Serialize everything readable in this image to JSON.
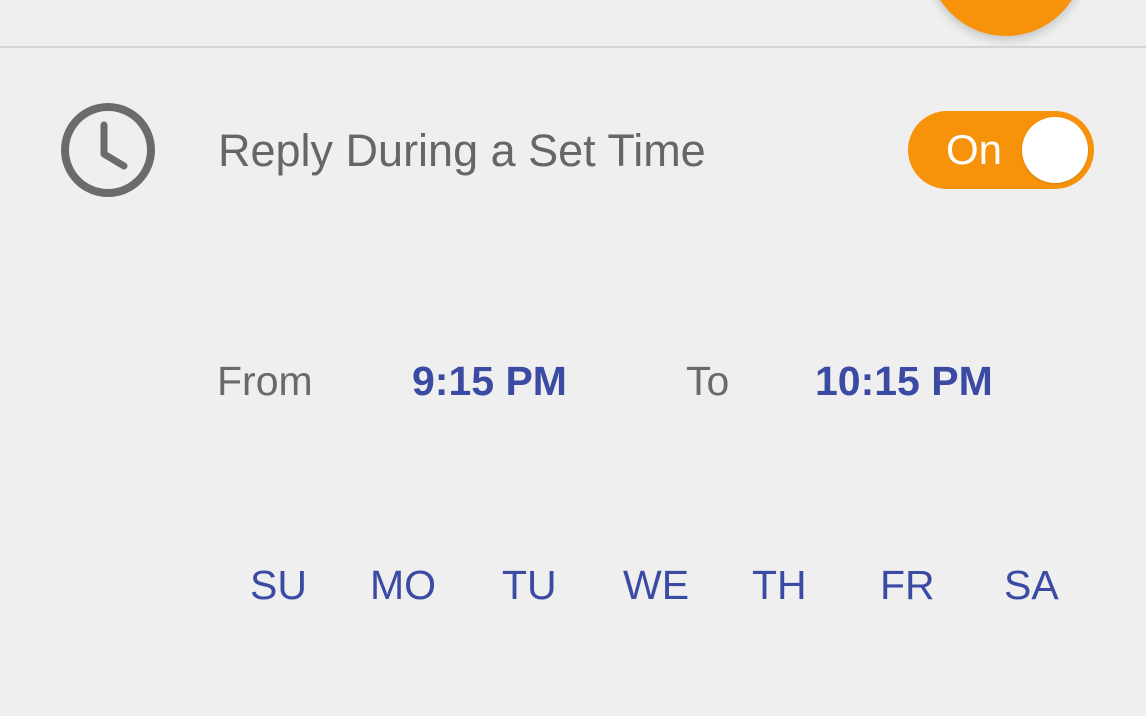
{
  "setting": {
    "icon": "clock-icon",
    "label": "Reply During a Set Time",
    "toggle_label": "On",
    "toggle_state": true
  },
  "schedule": {
    "from_label": "From",
    "from_value": "9:15 PM",
    "to_label": "To",
    "to_value": "10:15 PM"
  },
  "days": [
    "SU",
    "MO",
    "TU",
    "WE",
    "TH",
    "FR",
    "SA"
  ],
  "colors": {
    "accent": "#f7930a",
    "link": "#3b4aa3",
    "text": "#666666",
    "background": "#efefef"
  }
}
